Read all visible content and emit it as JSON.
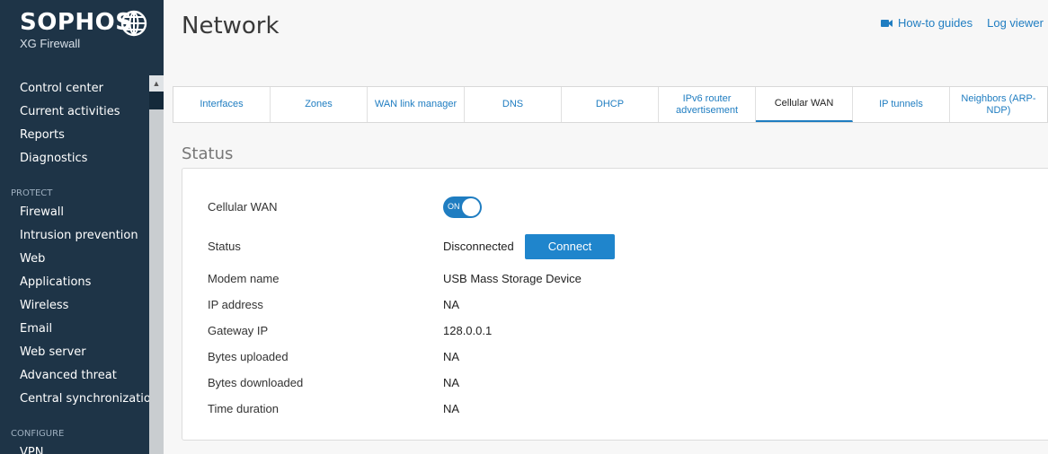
{
  "brand": {
    "name": "SOPHOS",
    "product": "XG Firewall"
  },
  "sidebar": {
    "items_main": [
      {
        "label": "Control center"
      },
      {
        "label": "Current activities"
      },
      {
        "label": "Reports"
      },
      {
        "label": "Diagnostics"
      }
    ],
    "section_protect": "PROTECT",
    "items_protect": [
      {
        "label": "Firewall"
      },
      {
        "label": "Intrusion prevention"
      },
      {
        "label": "Web"
      },
      {
        "label": "Applications"
      },
      {
        "label": "Wireless"
      },
      {
        "label": "Email"
      },
      {
        "label": "Web server"
      },
      {
        "label": "Advanced threat"
      },
      {
        "label": "Central synchronization"
      }
    ],
    "section_configure": "CONFIGURE",
    "items_configure": [
      {
        "label": "VPN"
      }
    ]
  },
  "header": {
    "title": "Network",
    "how_to": "How-to guides",
    "log_viewer": "Log viewer"
  },
  "tabs": [
    {
      "label": "Interfaces"
    },
    {
      "label": "Zones"
    },
    {
      "label": "WAN link manager"
    },
    {
      "label": "DNS"
    },
    {
      "label": "DHCP"
    },
    {
      "label": "IPv6 router advertisement"
    },
    {
      "label": "Cellular WAN"
    },
    {
      "label": "IP tunnels"
    },
    {
      "label": "Neighbors (ARP-NDP)"
    }
  ],
  "status": {
    "section_title": "Status",
    "cellular_wan_label": "Cellular WAN",
    "toggle_state": "ON",
    "status_label": "Status",
    "status_value": "Disconnected",
    "connect_button": "Connect",
    "modem_label": "Modem name",
    "modem_value": "USB Mass Storage Device",
    "ip_label": "IP address",
    "ip_value": "NA",
    "gateway_label": "Gateway IP",
    "gateway_value": "128.0.0.1",
    "up_label": "Bytes uploaded",
    "up_value": "NA",
    "down_label": "Bytes downloaded",
    "down_value": "NA",
    "duration_label": "Time duration",
    "duration_value": "NA"
  },
  "colors": {
    "sidebar": "#1e3447",
    "accent": "#1f7dc1"
  }
}
